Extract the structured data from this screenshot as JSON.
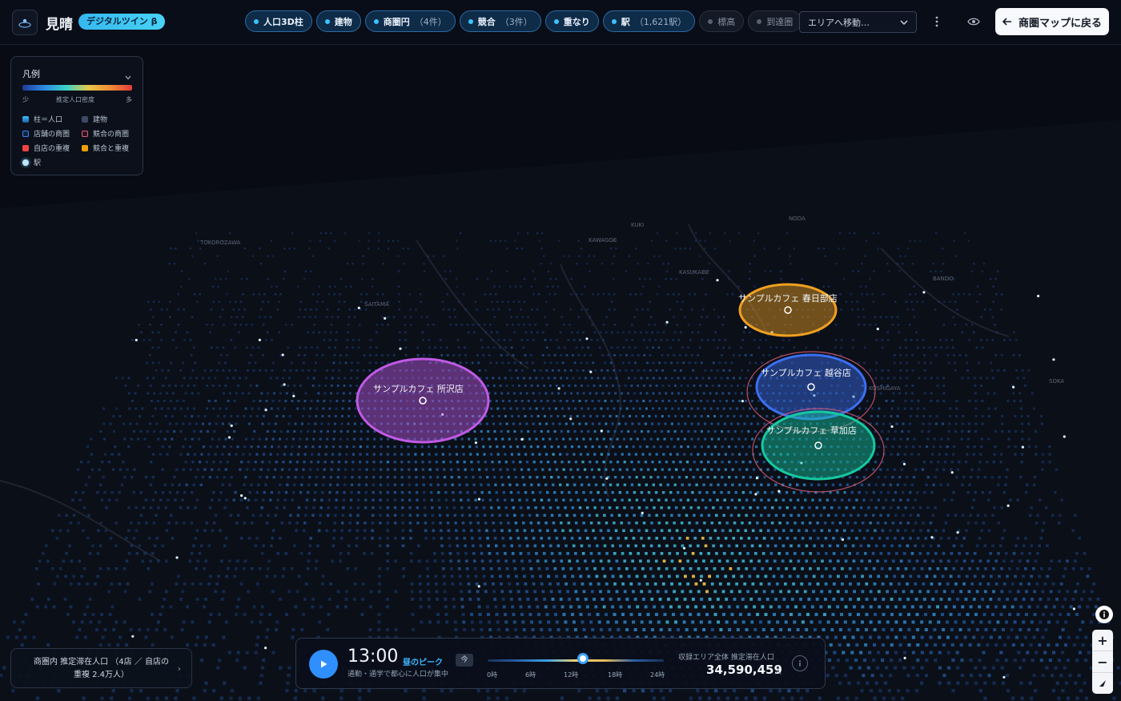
{
  "app": {
    "title": "見晴",
    "badge": "デジタルツイン β"
  },
  "toolbar": {
    "layers": [
      {
        "label": "人口3D柱",
        "count": "",
        "active": true
      },
      {
        "label": "建物",
        "count": "",
        "active": true
      },
      {
        "label": "商圏円",
        "count": "（4件）",
        "active": true
      },
      {
        "label": "競合",
        "count": "（3件）",
        "active": true
      },
      {
        "label": "重なり",
        "count": "",
        "active": true
      },
      {
        "label": "駅",
        "count": "（1,621駅）",
        "active": true
      },
      {
        "label": "標高",
        "count": "",
        "active": false
      },
      {
        "label": "到達圏",
        "count": "",
        "active": false
      }
    ],
    "area_select_placeholder": "エリアへ移動…",
    "back_label": "商圏マップに戻る"
  },
  "legend": {
    "title": "凡例",
    "gradient_low": "少",
    "gradient_mid": "推定人口密度",
    "gradient_high": "多",
    "items": [
      {
        "label": "柱＝人口",
        "color": "#2f8fd8"
      },
      {
        "label": "建物",
        "color": "#3c4a66"
      },
      {
        "label": "店舗の商圏",
        "color": "#3b82f6"
      },
      {
        "label": "競合の商圏",
        "color": "#e0607a"
      },
      {
        "label": "自店の重複",
        "color": "#ef4444"
      },
      {
        "label": "競合と重複",
        "color": "#f59e0b"
      },
      {
        "label": "駅",
        "color": "#bfe7ff"
      }
    ]
  },
  "stores": [
    {
      "name": "サンプルカフェ 所沢店",
      "color": "#c05ae6"
    },
    {
      "name": "サンプルカフェ 春日部店",
      "color": "#f0a020"
    },
    {
      "name": "サンプルカフェ 越谷店",
      "color": "#3b6ff2"
    },
    {
      "name": "サンプルカフェ 草加店",
      "color": "#16c9a0"
    }
  ],
  "map_labels": [
    "KAWAGOE",
    "KUKI",
    "KASUKABE",
    "KOSHIGAYA",
    "SOKA",
    "SAITAMA",
    "TOKOROZAWA",
    "NODA",
    "BANDO"
  ],
  "stats": {
    "line1": "商圏内 推定滞在人口 （4店 ／ 自店の",
    "line2": "重複 2.4万人）"
  },
  "time": {
    "clock": "13:00",
    "peak_label": "昼のピーク",
    "now_label": "今",
    "hint": "通勤・通学で都心に人口が集中",
    "hour": 13,
    "ticks": [
      "0時",
      "6時",
      "12時",
      "18時",
      "24時"
    ],
    "total_label": "収録エリア全体 推定滞在人口",
    "total_value": "34,590,459",
    "total_unit": "人"
  },
  "colors": {
    "accent": "#2f8fff",
    "badge": "#3bc3ff",
    "panel": "#0c111c"
  }
}
